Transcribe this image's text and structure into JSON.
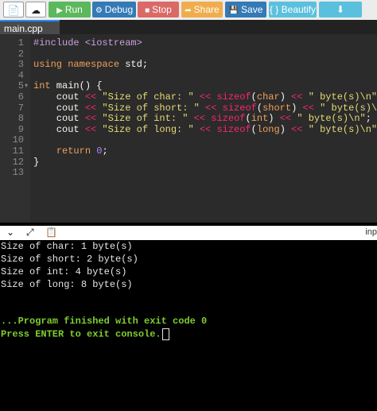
{
  "toolbar": {
    "run_label": "Run",
    "debug_label": "Debug",
    "stop_label": "Stop",
    "share_label": "Share",
    "save_label": "Save",
    "beautify_label": "{ } Beautify",
    "colors": {
      "run": "#5cb85c",
      "debug": "#337ab7",
      "stop": "#d9534f",
      "share": "#f0ad4e",
      "save": "#337ab7",
      "beautify": "#5bc0de"
    }
  },
  "tab": {
    "filename": "main.cpp"
  },
  "editor": {
    "lines": [
      {
        "num": "1",
        "text": "#include <iostream>"
      },
      {
        "num": "2",
        "text": ""
      },
      {
        "num": "3",
        "text": "using namespace std;"
      },
      {
        "num": "4",
        "text": ""
      },
      {
        "num": "5",
        "text": "int main() {"
      },
      {
        "num": "6",
        "text": "    cout << \"Size of char: \" << sizeof(char) << \" byte(s)\\n\";"
      },
      {
        "num": "7",
        "text": "    cout << \"Size of short: \" << sizeof(short) << \" byte(s)\\n\";"
      },
      {
        "num": "8",
        "text": "    cout << \"Size of int: \" << sizeof(int) << \" byte(s)\\n\";"
      },
      {
        "num": "9",
        "text": "    cout << \"Size of long: \" << sizeof(long) << \" byte(s)\\n\";"
      },
      {
        "num": "10",
        "text": ""
      },
      {
        "num": "11",
        "text": "    return 0;"
      },
      {
        "num": "12",
        "text": "}"
      },
      {
        "num": "13",
        "text": ""
      }
    ]
  },
  "console_bar": {
    "input_label": "inp"
  },
  "console": {
    "output": [
      "Size of char: 1 byte(s)",
      "Size of short: 2 byte(s)",
      "Size of int: 4 byte(s)",
      "Size of long: 8 byte(s)"
    ],
    "finished": "...Program finished with exit code 0",
    "prompt": "Press ENTER to exit console."
  }
}
